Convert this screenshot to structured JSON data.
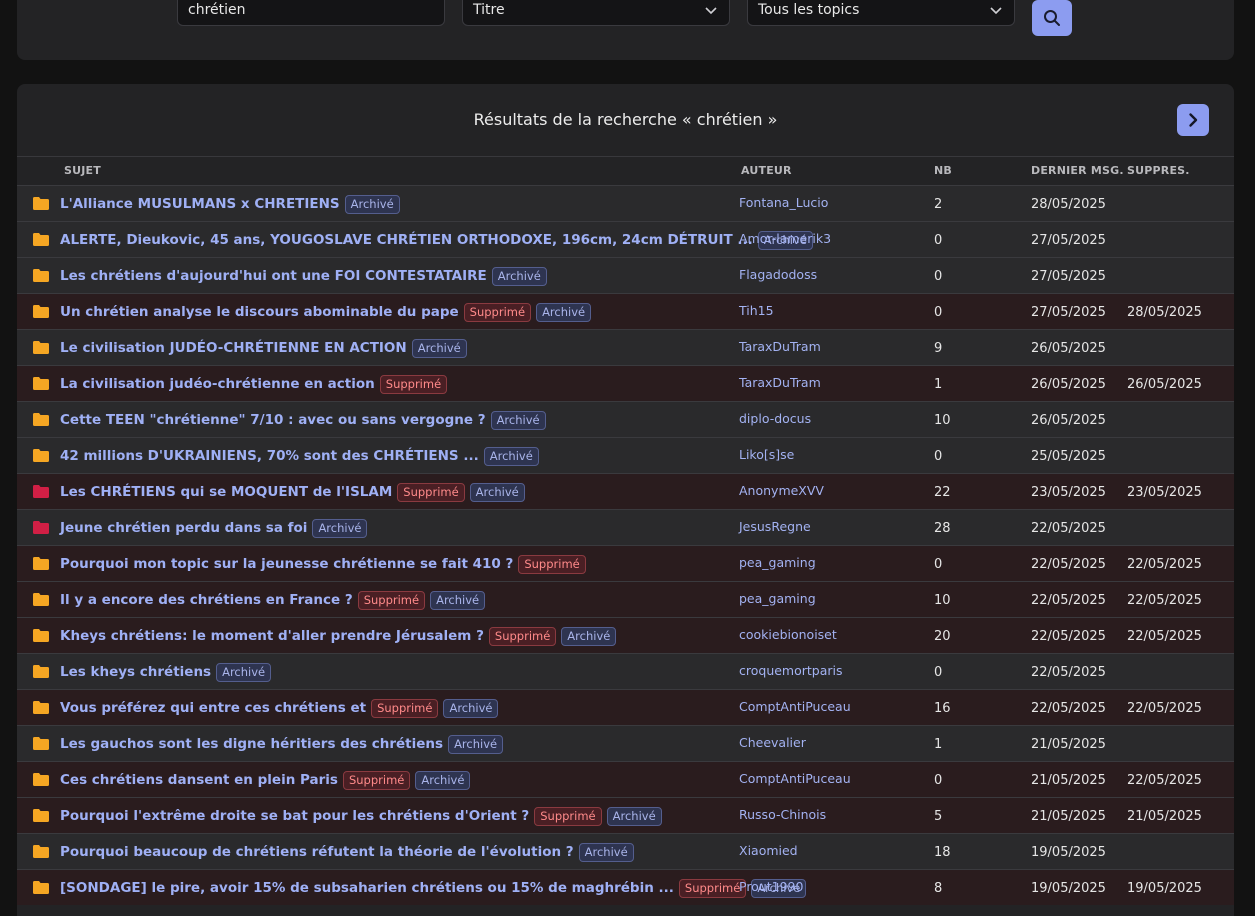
{
  "search": {
    "query": "chrétien",
    "field_type": "Titre",
    "scope": "Tous les topics"
  },
  "results": {
    "title": "Résultats de la recherche « chrétien »",
    "columns": {
      "subject": "SUJET",
      "author": "AUTEUR",
      "nb": "NB",
      "last": "DERNIER MSG.",
      "deleted": "SUPPRES."
    },
    "badge_archived": "Archivé",
    "badge_deleted": "Supprimé",
    "rows": [
      {
        "title": "L'Alliance MUSULMANS x CHRETIENS",
        "supprime": false,
        "archive": true,
        "author": "Fontana_Lucio",
        "nb": "2",
        "last": "28/05/2025",
        "deleted_date": "",
        "folder": "#f5a623"
      },
      {
        "title": "ALERTE, Dieukovic, 45 ans, YOUGOSLAVE CHRÉTIEN ORTHODOXE, 196cm, 24cm DÉTRUIT ...",
        "supprime": false,
        "archive": true,
        "author": "Amor-lamerik3",
        "nb": "0",
        "last": "27/05/2025",
        "deleted_date": "",
        "folder": "#f5a623"
      },
      {
        "title": "Les chrétiens d'aujourd'hui ont une FOI CONTESTATAIRE",
        "supprime": false,
        "archive": true,
        "author": "Flagadodoss",
        "nb": "0",
        "last": "27/05/2025",
        "deleted_date": "",
        "folder": "#f5a623"
      },
      {
        "title": "Un chrétien analyse le discours abominable du pape",
        "supprime": true,
        "archive": true,
        "author": "Tih15",
        "nb": "0",
        "last": "27/05/2025",
        "deleted_date": "28/05/2025",
        "folder": "#f5a623"
      },
      {
        "title": "Le civilisation JUDÉO-CHRÉTIENNE EN ACTION",
        "supprime": false,
        "archive": true,
        "author": "TaraxDuTram",
        "nb": "9",
        "last": "26/05/2025",
        "deleted_date": "",
        "folder": "#f5a623"
      },
      {
        "title": "La civilisation judéo-chrétienne en action",
        "supprime": true,
        "archive": false,
        "author": "TaraxDuTram",
        "nb": "1",
        "last": "26/05/2025",
        "deleted_date": "26/05/2025",
        "folder": "#f5a623"
      },
      {
        "title": "Cette TEEN \"chrétienne\" 7/10 : avec ou sans vergogne ?",
        "supprime": false,
        "archive": true,
        "author": "diplo-docus",
        "nb": "10",
        "last": "26/05/2025",
        "deleted_date": "",
        "folder": "#f5a623"
      },
      {
        "title": "42 millions D'UKRAINIENS, 70% sont des CHRÉTIENS ...",
        "supprime": false,
        "archive": true,
        "author": "Liko[s]se",
        "nb": "0",
        "last": "25/05/2025",
        "deleted_date": "",
        "folder": "#f5a623"
      },
      {
        "title": "Les CHRÉTIENS qui se MOQUENT de l'ISLAM",
        "supprime": true,
        "archive": true,
        "author": "AnonymeXVV",
        "nb": "22",
        "last": "23/05/2025",
        "deleted_date": "23/05/2025",
        "folder": "#d11f45"
      },
      {
        "title": "Jeune chrétien perdu dans sa foi",
        "supprime": false,
        "archive": true,
        "author": "JesusRegne",
        "nb": "28",
        "last": "22/05/2025",
        "deleted_date": "",
        "folder": "#d11f45"
      },
      {
        "title": "Pourquoi mon topic sur la jeunesse chrétienne se fait 410 ?",
        "supprime": true,
        "archive": false,
        "author": "pea_gaming",
        "nb": "0",
        "last": "22/05/2025",
        "deleted_date": "22/05/2025",
        "folder": "#f5a623"
      },
      {
        "title": "Il y a encore des chrétiens en France ?",
        "supprime": true,
        "archive": true,
        "author": "pea_gaming",
        "nb": "10",
        "last": "22/05/2025",
        "deleted_date": "22/05/2025",
        "folder": "#f5a623"
      },
      {
        "title": "Kheys chrétiens: le moment d'aller prendre Jérusalem ?",
        "supprime": true,
        "archive": true,
        "author": "cookiebionoiset",
        "nb": "20",
        "last": "22/05/2025",
        "deleted_date": "22/05/2025",
        "folder": "#f5a623"
      },
      {
        "title": "Les kheys chrétiens",
        "supprime": false,
        "archive": true,
        "author": "croquemortparis",
        "nb": "0",
        "last": "22/05/2025",
        "deleted_date": "",
        "folder": "#f5a623"
      },
      {
        "title": "Vous préférez qui entre ces chrétiens et",
        "supprime": true,
        "archive": true,
        "author": "ComptAntiPuceau",
        "nb": "16",
        "last": "22/05/2025",
        "deleted_date": "22/05/2025",
        "folder": "#f5a623"
      },
      {
        "title": "Les gauchos sont les digne héritiers des chrétiens",
        "supprime": false,
        "archive": true,
        "author": "Cheevalier",
        "nb": "1",
        "last": "21/05/2025",
        "deleted_date": "",
        "folder": "#f5a623"
      },
      {
        "title": "Ces chrétiens dansent en plein Paris",
        "supprime": true,
        "archive": true,
        "author": "ComptAntiPuceau",
        "nb": "0",
        "last": "21/05/2025",
        "deleted_date": "22/05/2025",
        "folder": "#f5a623"
      },
      {
        "title": "Pourquoi l'extrême droite se bat pour les chrétiens d'Orient ?",
        "supprime": true,
        "archive": true,
        "author": "Russo-Chinois",
        "nb": "5",
        "last": "21/05/2025",
        "deleted_date": "21/05/2025",
        "folder": "#f5a623"
      },
      {
        "title": "Pourquoi beaucoup de chrétiens réfutent la théorie de l'évolution ?",
        "supprime": false,
        "archive": true,
        "author": "Xiaomied",
        "nb": "18",
        "last": "19/05/2025",
        "deleted_date": "",
        "folder": "#f5a623"
      },
      {
        "title": "[SONDAGE] le pire, avoir 15% de subsaharien chrétiens ou 15% de maghrébin ...",
        "supprime": true,
        "archive": true,
        "author": "Prout1990",
        "nb": "8",
        "last": "19/05/2025",
        "deleted_date": "19/05/2025",
        "folder": "#f5a623"
      }
    ]
  },
  "icons": {
    "search": "search-icon",
    "next": "chevron-right-icon",
    "dropdown": "chevron-down-icon",
    "folder": "folder-icon"
  },
  "colors": {
    "accent": "#8c9cf0",
    "link": "#9fb0f5",
    "folder_normal": "#f5a623",
    "folder_hot": "#d11f45"
  }
}
